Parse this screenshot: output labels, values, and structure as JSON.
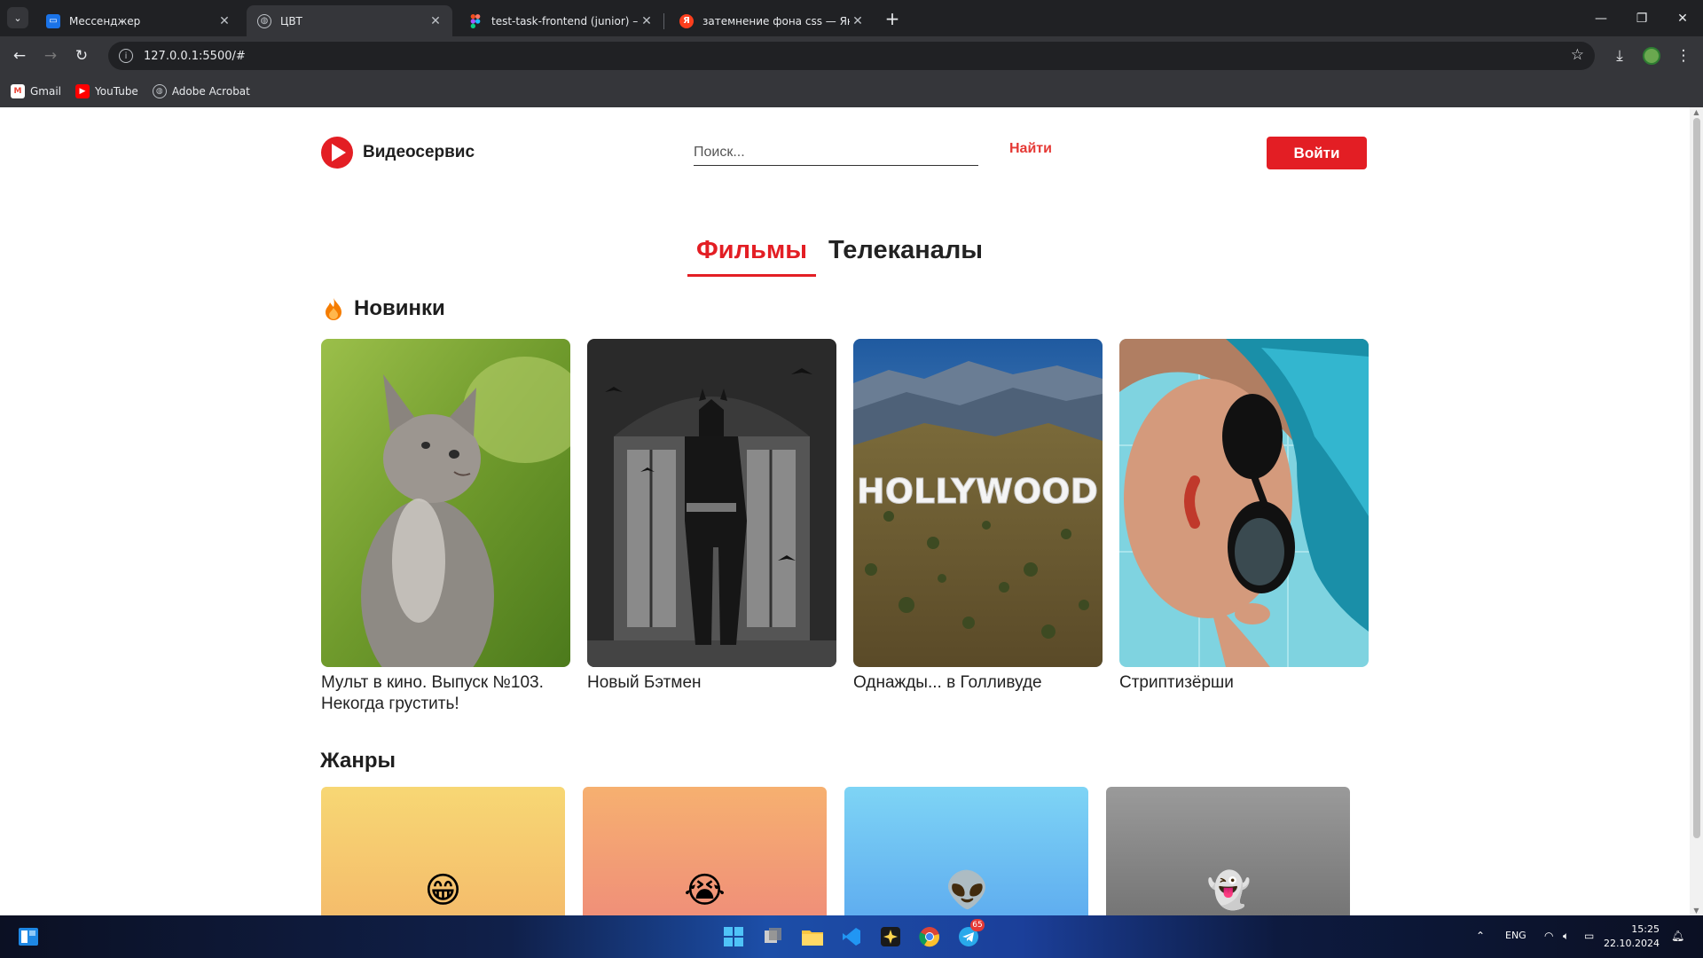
{
  "browser": {
    "tabs": [
      {
        "title": "Мессенджер",
        "icon": "messenger-icon",
        "active": false
      },
      {
        "title": "ЦВТ",
        "icon": "globe-icon",
        "active": true
      },
      {
        "title": "test-task-frontend (junior) – Fig",
        "icon": "figma-icon",
        "active": false
      },
      {
        "title": "затемнение фона css — Яндек",
        "icon": "yandex-icon",
        "active": false
      }
    ],
    "url": "127.0.0.1:5500/#",
    "bookmarks": [
      {
        "label": "Gmail",
        "icon": "gmail-icon"
      },
      {
        "label": "YouTube",
        "icon": "youtube-icon"
      },
      {
        "label": "Adobe Acrobat",
        "icon": "acrobat-icon"
      }
    ]
  },
  "site": {
    "logo_text": "Видеосервис",
    "search_placeholder": "Поиск...",
    "find_label": "Найти",
    "login_label": "Войти",
    "tabs": [
      {
        "label": "Фильмы",
        "active": true
      },
      {
        "label": "Телеканалы",
        "active": false
      }
    ],
    "new_section_title": "Новинки",
    "movies": [
      {
        "title": "Мульт в кино. Выпуск №103. Некогда грустить!",
        "poster": "kitten"
      },
      {
        "title": "Новый Бэтмен",
        "poster": "batman"
      },
      {
        "title": "Однажды... в Голливуде",
        "poster": "hollywood"
      },
      {
        "title": "Стриптизёрши",
        "poster": "blue-hair-woman"
      }
    ],
    "hollywood_sign": "HOLLYWOOD",
    "genres_title": "Жанры",
    "genres": [
      {
        "emoji": "😁",
        "name": "grin",
        "color_top": "#f7d774",
        "color_bottom": "#f4b86a"
      },
      {
        "emoji": "😭",
        "name": "cry",
        "color_top": "#f6b070",
        "color_bottom": "#ef8a7a"
      },
      {
        "emoji": "👽",
        "name": "alien",
        "color_top": "#7ed4f5",
        "color_bottom": "#5aa7ef"
      },
      {
        "emoji": "👻",
        "name": "ghost",
        "color_top": "#9a9a9a",
        "color_bottom": "#6f6f6f"
      }
    ],
    "accent_color": "#e31e24"
  },
  "taskbar": {
    "language": "ENG",
    "time": "15:25",
    "date": "22.10.2024",
    "telegram_badge": "65"
  }
}
